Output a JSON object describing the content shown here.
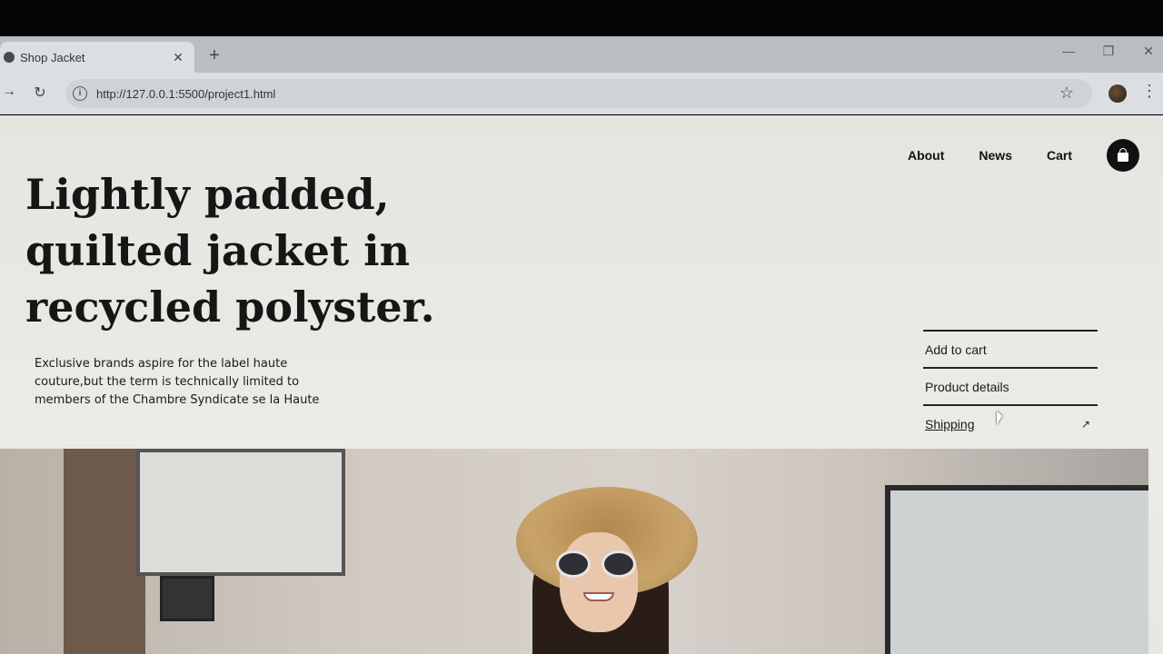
{
  "browser": {
    "tab_title": "Shop Jacket",
    "tab_close": "✕",
    "new_tab": "+",
    "url": "http://127.0.0.1:5500/project1.html",
    "window_controls": {
      "minimize": "—",
      "restore": "❐",
      "close": "✕"
    },
    "icons": [
      "back-arrow-icon",
      "reload-icon",
      "info-icon",
      "bookmark-star-icon",
      "profile-avatar",
      "kebab-menu-icon"
    ]
  },
  "nav": {
    "links": [
      "About",
      "News",
      "Cart"
    ],
    "bag_icon": "shopping-bag-icon"
  },
  "hero": {
    "headline_lines": [
      "Lightly padded,",
      "quilted jacket in",
      "recycled polyster."
    ],
    "subtext_lines": [
      "Exclusive brands aspire for the label haute",
      "couture,but the term is technically limited to",
      "members of the Chambre Syndicate se la Haute"
    ]
  },
  "actions": [
    {
      "label": "Add to cart"
    },
    {
      "label": "Product details"
    },
    {
      "label": "Shipping",
      "arrow": "↗"
    }
  ],
  "colors": {
    "page_bg": "#e8e7e2",
    "text": "#161616",
    "bag_button": "#111111"
  }
}
